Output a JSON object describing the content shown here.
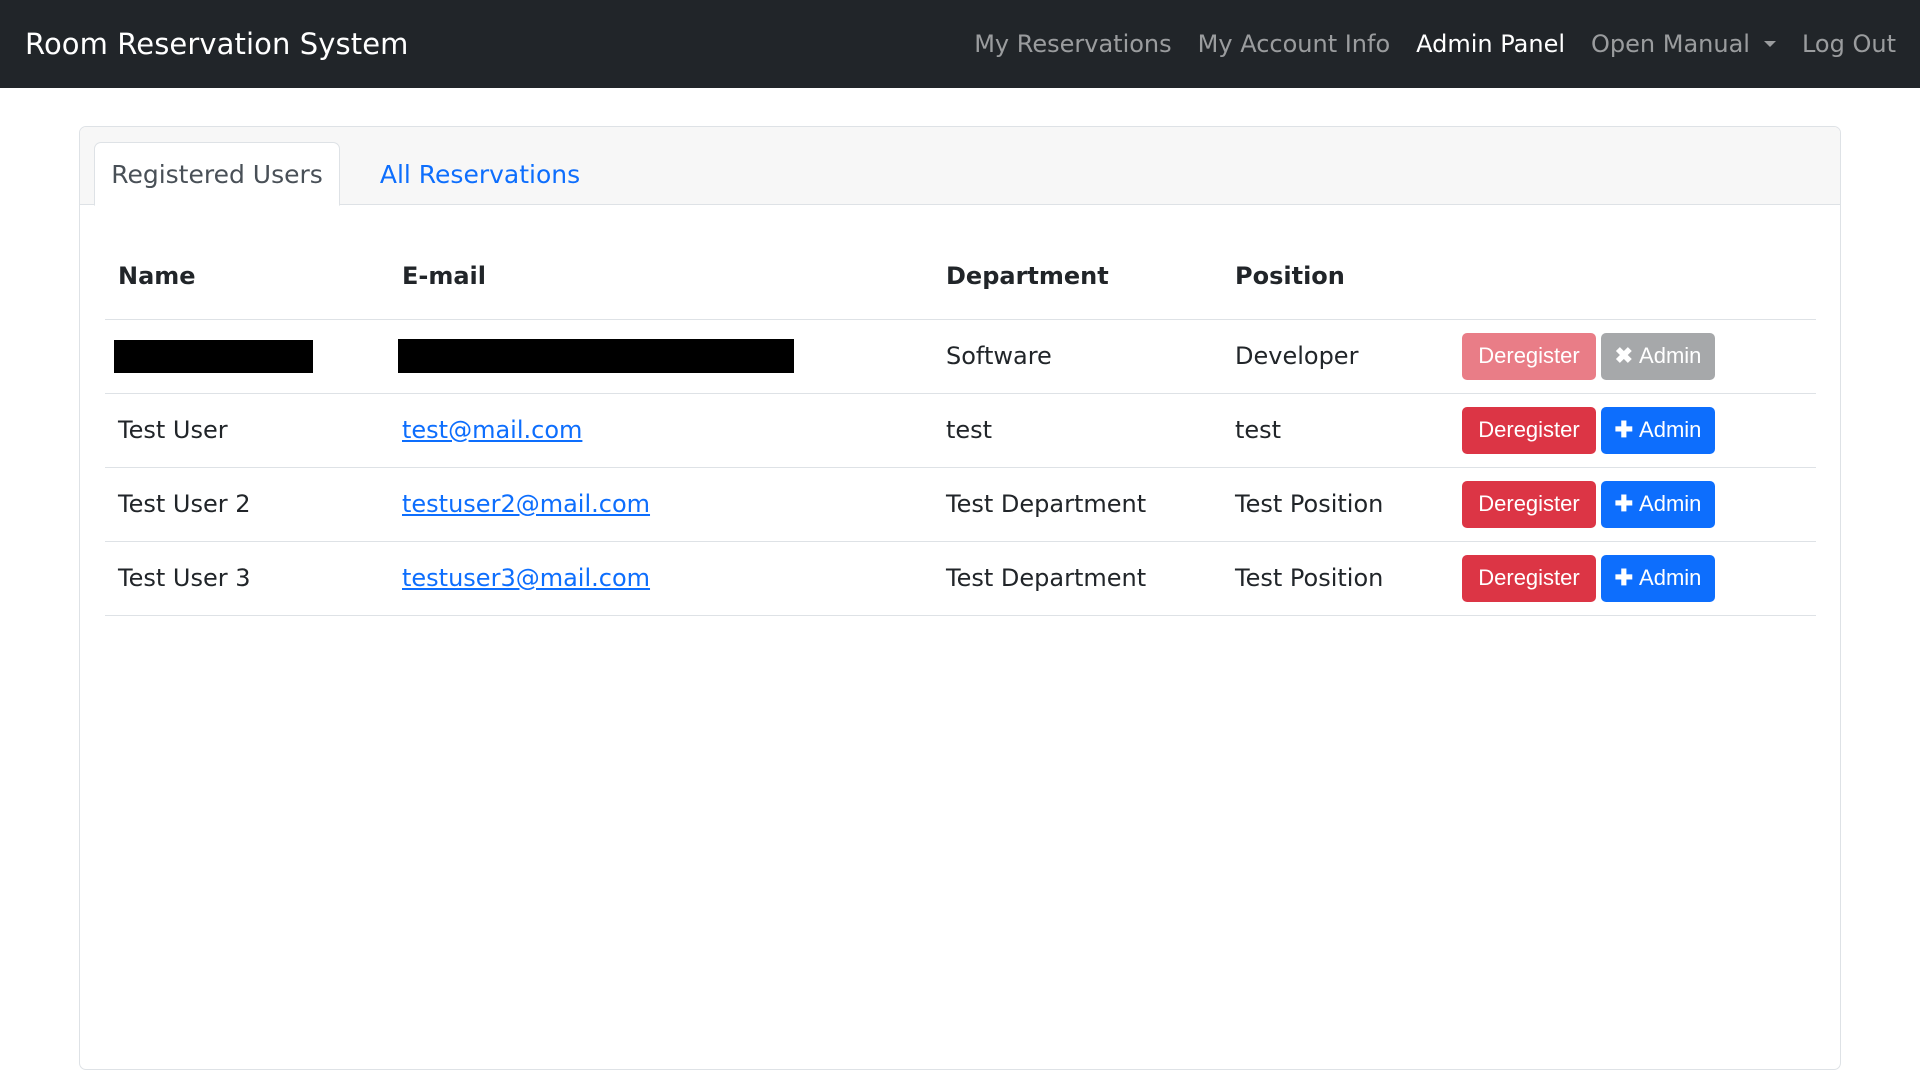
{
  "app": {
    "title": "Room Reservation System"
  },
  "nav": {
    "items": [
      {
        "label": "My Reservations"
      },
      {
        "label": "My Account Info"
      },
      {
        "label": "Admin Panel"
      },
      {
        "label": "Open Manual"
      },
      {
        "label": "Log Out"
      }
    ]
  },
  "tabs": [
    {
      "label": "Registered Users"
    },
    {
      "label": "All Reservations"
    }
  ],
  "table": {
    "headers": [
      "Name",
      "E-mail",
      "Department",
      "Position"
    ],
    "rows": [
      {
        "name": "",
        "email": "",
        "department": "Software",
        "position": "Developer"
      },
      {
        "name": "Test User",
        "email": "test@mail.com",
        "department": "test",
        "position": "test"
      },
      {
        "name": "Test User 2",
        "email": "testuser2@mail.com",
        "department": "Test Department",
        "position": "Test Position"
      },
      {
        "name": "Test User 3",
        "email": "testuser3@mail.com",
        "department": "Test Department",
        "position": "Test Position"
      }
    ]
  },
  "buttons": {
    "deregister": "Deregister",
    "admin": "Admin"
  },
  "icons": {
    "add": "plus-icon",
    "remove": "x-icon"
  },
  "colors": {
    "navbar": "#212529",
    "link": "#0d6efd",
    "danger": "#dc3545",
    "primary": "#0d6efd",
    "secondary": "#a6a8aa"
  }
}
